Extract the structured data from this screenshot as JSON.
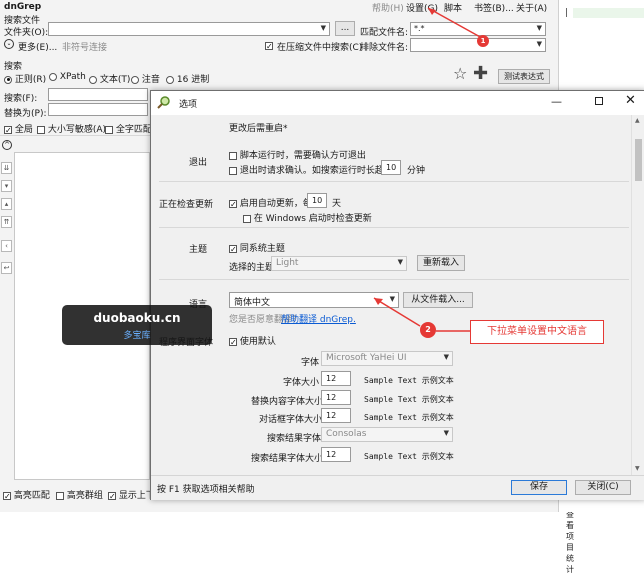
{
  "main": {
    "title": "dnGrep",
    "menu": [
      "帮助(H)",
      "设置(G)",
      "脚本",
      "书签(B)...",
      "关于(A)"
    ],
    "search_files_label": "搜索文件",
    "folder_label": "文件夹(O):",
    "browse_button": "...",
    "match_filename_label": "匹配文件名:",
    "match_filename_value": "*.*",
    "more_label": "更多(E)...",
    "more_hint": "非符号连接",
    "search_in_archives": "在压缩文件中搜索(C)",
    "exclude_filename_label": "排除文件名:",
    "search_label": "搜索",
    "search_types": [
      "正则(R)",
      "XPath",
      "文本(T)",
      "注音",
      "16 进制"
    ],
    "test_expr_button": "测试表达式",
    "search_field_label": "搜索(F):",
    "replace_field_label": "替换为(P):",
    "options": [
      "全局",
      "大小写敏感(A)",
      "全字匹配"
    ],
    "bottom_options": [
      "高亮匹配",
      "高亮群组",
      "显示上下"
    ],
    "show_results_label": "查看项目统计"
  },
  "dialog": {
    "title": "选项",
    "restart_note": "更改后需重启*",
    "exit_label": "退出",
    "exit_opt1": "脚本运行时，需要确认方可退出",
    "exit_opt2": "退出时请求确认。如搜索运行时长超过",
    "exit_minutes_value": "10",
    "exit_minutes_unit": "分钟",
    "update_label": "正在检查更新",
    "update_opt": "启用自动更新，每",
    "update_days_value": "10",
    "update_days_unit": "天",
    "startup_opt": "在 Windows 启动时检查更新",
    "theme_label": "主题",
    "theme_follow": "同系统主题",
    "theme_choose_label": "选择的主题",
    "theme_choose_value": "Light",
    "reload_button": "重新载入",
    "language_label": "语言",
    "language_value": "简体中文",
    "load_from_file_button": "从文件载入...",
    "translate_prefix": "您是否愿意翻译？",
    "translate_link": "帮助翻译 dnGrep.",
    "ui_label": "程序界面字体",
    "ui_opt": "使用默认",
    "font_label": "字体",
    "font_value": "Microsoft YaHei UI",
    "font_rows": [
      {
        "label": "字体大小",
        "value": "12",
        "sample": "Sample Text 示例文本"
      },
      {
        "label": "替换内容字体大小",
        "value": "12",
        "sample": "Sample Text 示例文本"
      },
      {
        "label": "对话框字体大小",
        "value": "12",
        "sample": "Sample Text 示例文本"
      }
    ],
    "result_font_label": "搜索结果字体",
    "result_font_value": "Consolas",
    "result_size_label": "搜索结果字体大小",
    "result_size_value": "12",
    "result_size_sample": "Sample Text 示例文本",
    "footer_hint": "按 F1 获取选项相关帮助",
    "save_button": "保存",
    "close_button": "关闭(C)"
  },
  "annotations": {
    "marker1": "1",
    "marker2": "2",
    "callout": "下拉菜单设置中文语言",
    "color": "#e53935"
  },
  "watermark": {
    "line1": "duobaoku.cn",
    "line2": "多宝库"
  }
}
